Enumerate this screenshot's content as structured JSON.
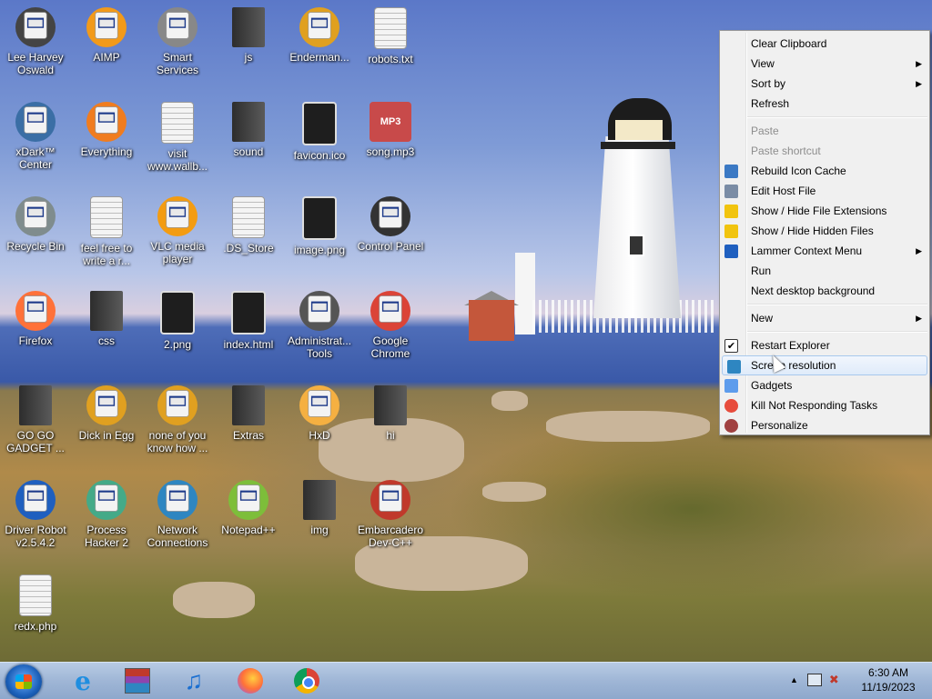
{
  "desktop_icons": [
    {
      "label": "Lee Harvey Oswald",
      "icon": "person-icon"
    },
    {
      "label": "AIMP",
      "icon": "aimp-icon"
    },
    {
      "label": "Smart Services",
      "icon": "gears-icon"
    },
    {
      "label": "js",
      "icon": "folder-icon"
    },
    {
      "label": "Enderman...",
      "icon": "app-icon"
    },
    {
      "label": "robots.txt",
      "icon": "text-file-icon"
    },
    {
      "label": "xDark™ Center",
      "icon": "xdark-icon"
    },
    {
      "label": "Everything",
      "icon": "search-icon"
    },
    {
      "label": "visit www.wallb...",
      "icon": "document-icon"
    },
    {
      "label": "sound",
      "icon": "folder-icon"
    },
    {
      "label": "favicon.ico",
      "icon": "image-file-icon"
    },
    {
      "label": "song.mp3",
      "icon": "mp3-icon"
    },
    {
      "label": "Recycle Bin",
      "icon": "recycle-bin-icon"
    },
    {
      "label": "feel free to write a r...",
      "icon": "text-file-icon"
    },
    {
      "label": "VLC media player",
      "icon": "vlc-icon"
    },
    {
      "label": ".DS_Store",
      "icon": "file-icon"
    },
    {
      "label": "image.png",
      "icon": "image-file-icon"
    },
    {
      "label": "Control Panel",
      "icon": "control-panel-icon"
    },
    {
      "label": "Firefox",
      "icon": "firefox-icon"
    },
    {
      "label": "css",
      "icon": "folder-icon"
    },
    {
      "label": "2.png",
      "icon": "image-file-icon"
    },
    {
      "label": "index.html",
      "icon": "html-file-icon"
    },
    {
      "label": "Administrat... Tools",
      "icon": "admin-tools-icon"
    },
    {
      "label": "Google Chrome",
      "icon": "chrome-icon"
    },
    {
      "label": "GO GO GADGET ...",
      "icon": "folder-icon"
    },
    {
      "label": "Dick in Egg",
      "icon": "app-icon"
    },
    {
      "label": "none of you know how ...",
      "icon": "app-icon"
    },
    {
      "label": "Extras",
      "icon": "folder-icon"
    },
    {
      "label": "HxD",
      "icon": "hxd-icon"
    },
    {
      "label": "hi",
      "icon": "folder-icon"
    },
    {
      "label": "Driver Robot v2.5.4.2",
      "icon": "shield-icon"
    },
    {
      "label": "Process Hacker 2",
      "icon": "process-hacker-icon"
    },
    {
      "label": "Network Connections",
      "icon": "network-icon"
    },
    {
      "label": "Notepad++",
      "icon": "notepadpp-icon"
    },
    {
      "label": "img",
      "icon": "folder-icon"
    },
    {
      "label": "Embarcadero Dev-C++",
      "icon": "devcpp-icon"
    },
    {
      "label": "redx.php",
      "icon": "php-file-icon"
    }
  ],
  "context_menu": {
    "items": [
      {
        "label": "Clear Clipboard",
        "type": "item"
      },
      {
        "label": "View",
        "type": "submenu"
      },
      {
        "label": "Sort by",
        "type": "submenu"
      },
      {
        "label": "Refresh",
        "type": "item"
      },
      {
        "type": "separator"
      },
      {
        "label": "Paste",
        "type": "disabled"
      },
      {
        "label": "Paste shortcut",
        "type": "disabled"
      },
      {
        "label": "Rebuild Icon Cache",
        "type": "item",
        "icon": "rebuild-icon"
      },
      {
        "label": "Edit Host File",
        "type": "item",
        "icon": "gear-icon"
      },
      {
        "label": "Show / Hide File Extensions",
        "type": "item",
        "icon": "shield-icon"
      },
      {
        "label": "Show / Hide Hidden Files",
        "type": "item",
        "icon": "shield-icon"
      },
      {
        "label": "Lammer Context Menu",
        "type": "submenu",
        "icon": "lammer-icon"
      },
      {
        "label": "Run",
        "type": "item"
      },
      {
        "label": "Next desktop background",
        "type": "item"
      },
      {
        "type": "separator"
      },
      {
        "label": "New",
        "type": "submenu"
      },
      {
        "type": "separator"
      },
      {
        "label": "Restart Explorer",
        "type": "item",
        "icon": "checkbox-icon"
      },
      {
        "label": "Screen resolution",
        "type": "hover",
        "icon": "monitor-icon"
      },
      {
        "label": "Gadgets",
        "type": "item",
        "icon": "gadgets-icon"
      },
      {
        "label": "Kill Not Responding Tasks",
        "type": "item",
        "icon": "kill-icon"
      },
      {
        "label": "Personalize",
        "type": "item",
        "icon": "personalize-icon"
      }
    ]
  },
  "taskbar": {
    "pinned": [
      {
        "name": "Internet Explorer",
        "icon": "internet-explorer-icon"
      },
      {
        "name": "WinRAR",
        "icon": "archive-icon"
      },
      {
        "name": "Music",
        "icon": "music-icon"
      },
      {
        "name": "Firefox",
        "icon": "firefox-icon"
      },
      {
        "name": "Google Chrome",
        "icon": "chrome-icon"
      }
    ],
    "clock": {
      "time": "6:30 AM",
      "date": "11/19/2023"
    }
  },
  "colors": {
    "menu_bg": "#f0f0f0",
    "menu_hover": "#dfebfa",
    "taskbar": "#9fb6d6",
    "disabled_text": "#8d8d8d"
  }
}
